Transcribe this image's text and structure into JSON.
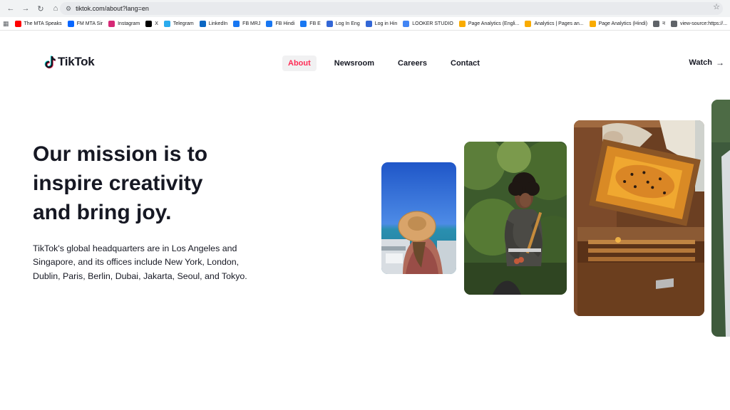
{
  "browser": {
    "url": "tiktok.com/about?lang=en",
    "bookmarks": [
      {
        "label": "The MTA Speaks",
        "icon": "youtube-icon",
        "color": "#ff0000"
      },
      {
        "label": "FM MTA Sir",
        "icon": "meta-icon",
        "color": "#0866ff"
      },
      {
        "label": "Instagram",
        "icon": "instagram-icon",
        "color": "#d62976"
      },
      {
        "label": "X",
        "icon": "x-icon",
        "color": "#000000"
      },
      {
        "label": "Telegram",
        "icon": "telegram-icon",
        "color": "#2aabee"
      },
      {
        "label": "LinkedIn",
        "icon": "linkedin-icon",
        "color": "#0a66c2"
      },
      {
        "label": "FB MRJ",
        "icon": "facebook-icon",
        "color": "#1877f2"
      },
      {
        "label": "FB Hindi",
        "icon": "facebook-icon",
        "color": "#1877f2"
      },
      {
        "label": "FB E",
        "icon": "facebook-icon",
        "color": "#1877f2"
      },
      {
        "label": "Log In Eng",
        "icon": "globe-icon",
        "color": "#3367d6"
      },
      {
        "label": "Log in Hin",
        "icon": "globe-icon",
        "color": "#3367d6"
      },
      {
        "label": "LOOKER STUDIO",
        "icon": "looker-icon",
        "color": "#4285f4"
      },
      {
        "label": "Page Analytics (Engli...",
        "icon": "analytics-icon",
        "color": "#f9ab00"
      },
      {
        "label": "Analytics | Pages an...",
        "icon": "analytics-icon",
        "color": "#f9ab00"
      },
      {
        "label": "Page Analytics (Hindi)",
        "icon": "analytics-icon",
        "color": "#f9ab00"
      },
      {
        "label": "न",
        "icon": "globe-icon",
        "color": "#5f6368"
      },
      {
        "label": "view-source:https://...",
        "icon": "globe-icon",
        "color": "#5f6368"
      }
    ]
  },
  "header": {
    "logo_text": "TikTok",
    "nav": [
      {
        "label": "About",
        "active": true
      },
      {
        "label": "Newsroom",
        "active": false
      },
      {
        "label": "Careers",
        "active": false
      },
      {
        "label": "Contact",
        "active": false
      }
    ],
    "watch_label": "Watch",
    "accent": "#fe2c55"
  },
  "hero": {
    "title_lines": [
      "Our mission is to",
      "inspire creativity",
      "and bring joy."
    ],
    "body": "TikTok's global headquarters are in Los Angeles and Singapore, and its offices include New York, London, Dublin, Paris, Berlin, Dubai, Jakarta, Seoul, and Tokyo."
  }
}
